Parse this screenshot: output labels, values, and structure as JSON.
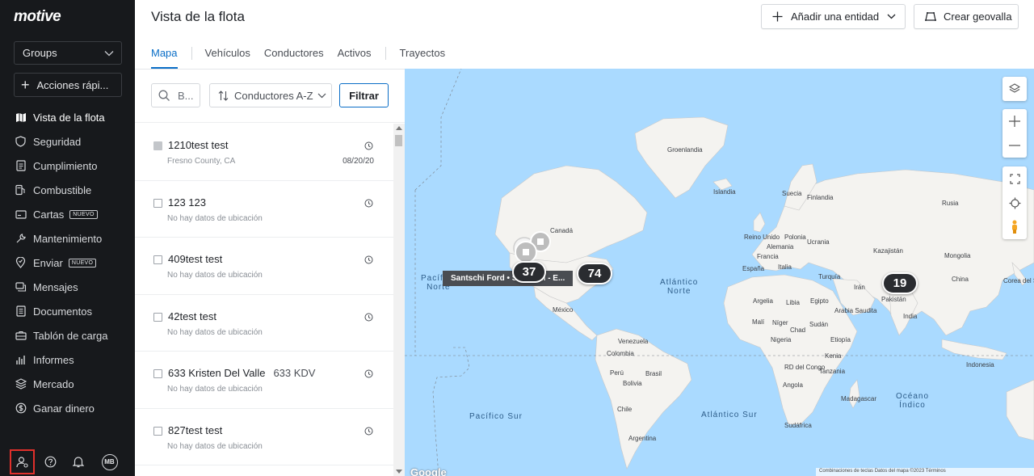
{
  "sidebar": {
    "logo": "motive",
    "groups_label": "Groups",
    "quick_actions_label": "Acciones rápi...",
    "items": [
      {
        "label": "Vista de la flota",
        "icon": "map-icon",
        "badge": ""
      },
      {
        "label": "Seguridad",
        "icon": "shield-icon",
        "badge": ""
      },
      {
        "label": "Cumplimiento",
        "icon": "document-icon",
        "badge": ""
      },
      {
        "label": "Combustible",
        "icon": "fuel-icon",
        "badge": ""
      },
      {
        "label": "Cartas",
        "icon": "card-icon",
        "badge": "NUEVO"
      },
      {
        "label": "Mantenimiento",
        "icon": "wrench-icon",
        "badge": ""
      },
      {
        "label": "Enviar",
        "icon": "dispatch-icon",
        "badge": "NUEVO"
      },
      {
        "label": "Mensajes",
        "icon": "messages-icon",
        "badge": ""
      },
      {
        "label": "Documentos",
        "icon": "documents-icon",
        "badge": ""
      },
      {
        "label": "Tablón de carga",
        "icon": "load-board-icon",
        "badge": ""
      },
      {
        "label": "Informes",
        "icon": "reports-icon",
        "badge": ""
      },
      {
        "label": "Mercado",
        "icon": "marketplace-icon",
        "badge": ""
      },
      {
        "label": "Ganar dinero",
        "icon": "money-icon",
        "badge": ""
      }
    ],
    "avatar_initials": "MB"
  },
  "header": {
    "title": "Vista de la flota",
    "add_entity_label": "Añadir una entidad",
    "create_geofence_label": "Crear geovalla"
  },
  "tabs": [
    "Mapa",
    "Vehículos",
    "Conductores",
    "Activos",
    "Trayectos"
  ],
  "toolbar": {
    "search_placeholder": "B...",
    "sort_label": "Conductores A-Z",
    "filter_label": "Filtrar"
  },
  "drivers": [
    {
      "name": "1210test test",
      "extra": "",
      "sub": "Fresno County, CA",
      "date": "08/20/20",
      "filled": true
    },
    {
      "name": "123 123",
      "extra": "",
      "sub": "No hay datos de ubicación",
      "date": "",
      "filled": false
    },
    {
      "name": "409test test",
      "extra": "",
      "sub": "No hay datos de ubicación",
      "date": "",
      "filled": false
    },
    {
      "name": "42test test",
      "extra": "",
      "sub": "No hay datos de ubicación",
      "date": "",
      "filled": false
    },
    {
      "name": "633 Kristen Del Valle",
      "extra": "633 KDV",
      "sub": "No hay datos de ubicación",
      "date": "",
      "filled": false
    },
    {
      "name": "827test test",
      "extra": "",
      "sub": "No hay datos de ubicación",
      "date": "",
      "filled": false
    }
  ],
  "map": {
    "clusters": [
      "37",
      "74",
      "19"
    ],
    "tooltip": "Santschi Ford • Santschi - E...",
    "oceans": {
      "pacific_north": "Pacífico\nNorte",
      "atlantic_north": "Atlántico\nNorte",
      "pacific_south": "Pacífico Sur",
      "atlantic_south": "Atlántico Sur",
      "indian": "Océano\nÍndico"
    },
    "labels": [
      "Groenlandia",
      "Islandia",
      "Suecia",
      "Finlandia",
      "Rusia",
      "Canadá",
      "Reino Unido",
      "Polonia",
      "Ucrania",
      "Kazajistán",
      "Francia",
      "Alemania",
      "Mongolia",
      "España",
      "Italia",
      "Turquía",
      "Corea del Sur",
      "Irán",
      "China",
      "Argelia",
      "Libia",
      "Egipto",
      "Arabia Saudita",
      "Pakistán",
      "India",
      "Malí",
      "Níger",
      "Chad",
      "Sudán",
      "Nigeria",
      "Etiopía",
      "Kenia",
      "Venezuela",
      "Colombia",
      "Perú",
      "Brasil",
      "Bolivia",
      "RD del Congo",
      "Angola",
      "Tanzania",
      "Indonesia",
      "Madagascar",
      "Chile",
      "Argentina",
      "Sudáfrica",
      "México",
      "Google"
    ],
    "attribution": "Combinaciones de teclas  Datos del mapa ©2023  Términos"
  }
}
